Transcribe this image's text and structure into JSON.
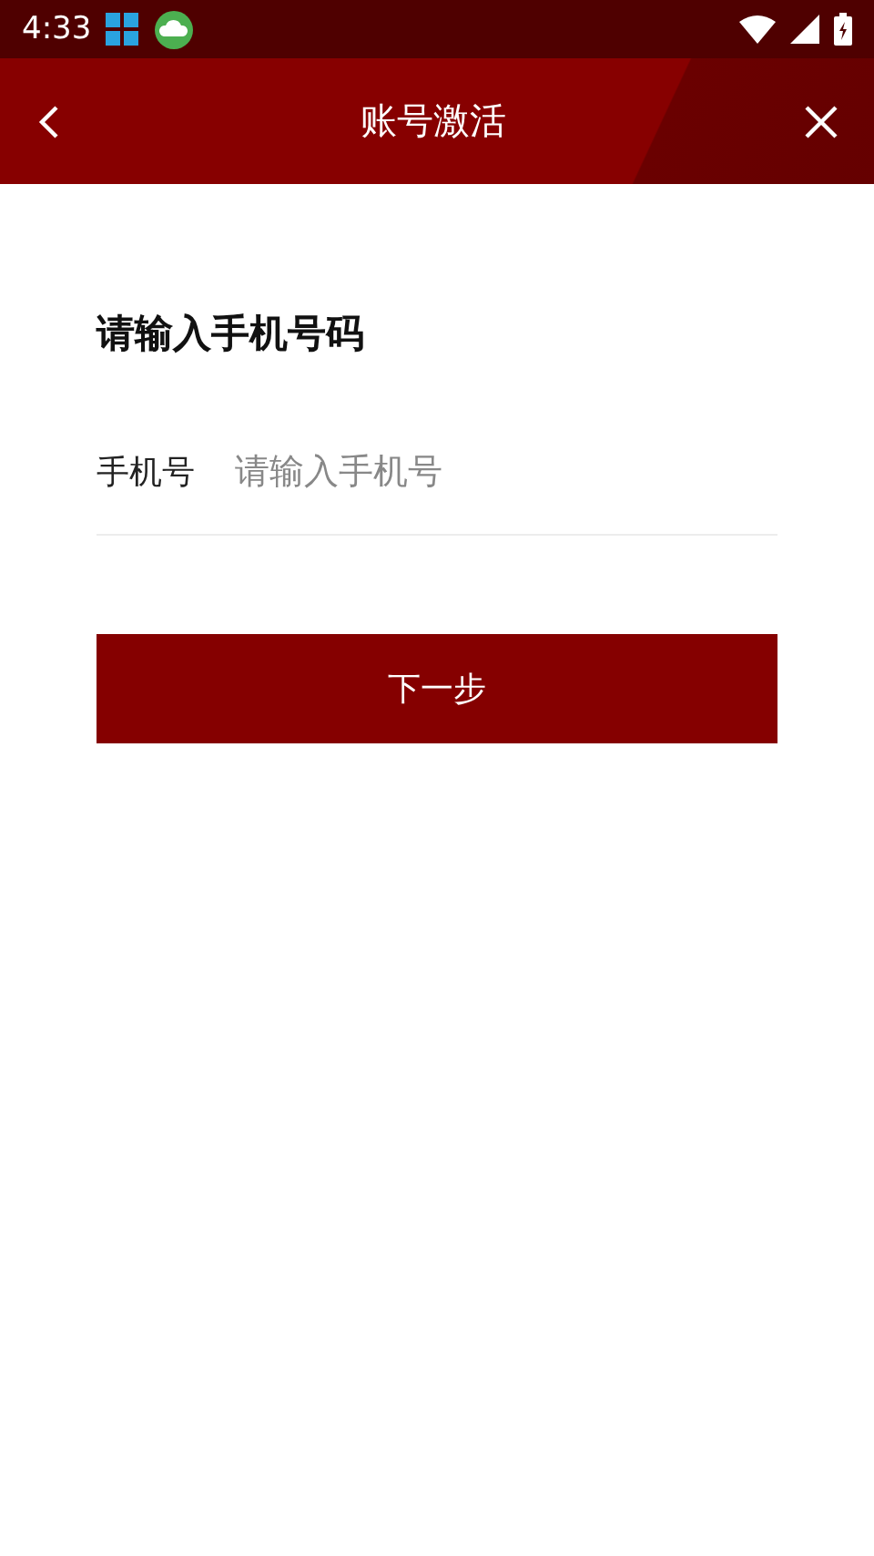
{
  "status_bar": {
    "time": "4:33"
  },
  "header": {
    "title": "账号激活"
  },
  "form": {
    "heading": "请输入手机号码",
    "phone_label": "手机号",
    "phone_placeholder": "请输入手机号",
    "next_button": "下一步"
  }
}
